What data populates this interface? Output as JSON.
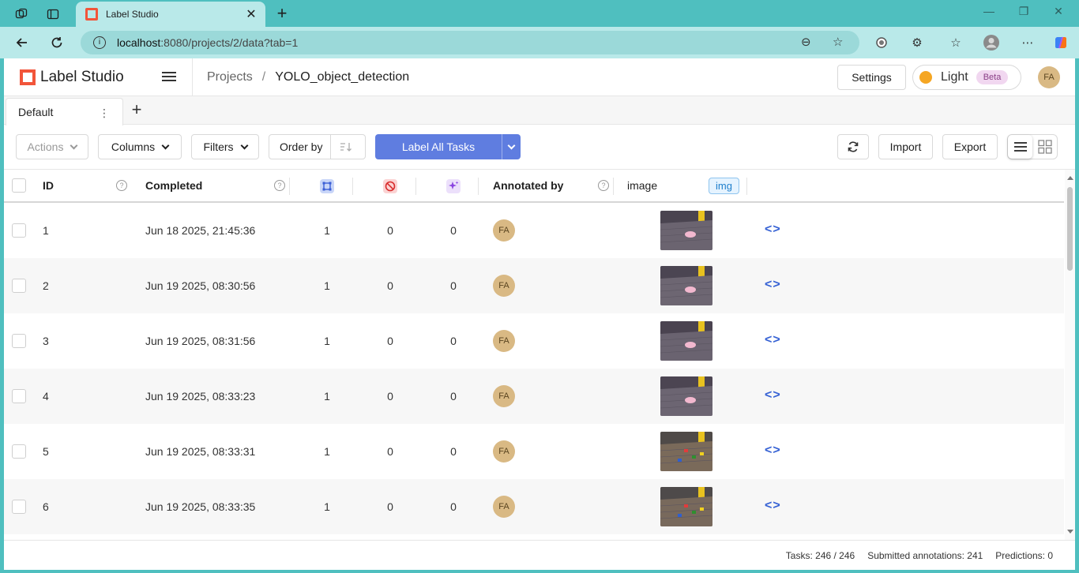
{
  "browser": {
    "tab_title": "Label Studio",
    "url_host": "localhost",
    "url_path": ":8080/projects/2/data?tab=1"
  },
  "app": {
    "logo_text": "Label Studio",
    "breadcrumb": {
      "parent": "Projects",
      "separator": "/",
      "current": "YOLO_object_detection"
    },
    "settings_label": "Settings",
    "theme_label": "Light",
    "theme_badge": "Beta",
    "user_initials": "FA"
  },
  "views": {
    "tabs": [
      {
        "label": "Default"
      }
    ],
    "menu_glyph": "⋮",
    "add_glyph": "+"
  },
  "toolbar": {
    "actions_label": "Actions",
    "columns_label": "Columns",
    "filters_label": "Filters",
    "order_label": "Order by",
    "label_all_label": "Label All Tasks",
    "import_label": "Import",
    "export_label": "Export"
  },
  "table": {
    "headers": {
      "id": "ID",
      "completed": "Completed",
      "annotated_by": "Annotated by",
      "image": "image",
      "image_badge": "img"
    },
    "rows": [
      {
        "id": "1",
        "completed": "Jun 18 2025, 21:45:36",
        "annotations": "1",
        "cancelled": "0",
        "predictions": "0",
        "annotator": "FA",
        "code": "<>"
      },
      {
        "id": "2",
        "completed": "Jun 19 2025, 08:30:56",
        "annotations": "1",
        "cancelled": "0",
        "predictions": "0",
        "annotator": "FA",
        "code": "<>"
      },
      {
        "id": "3",
        "completed": "Jun 19 2025, 08:31:56",
        "annotations": "1",
        "cancelled": "0",
        "predictions": "0",
        "annotator": "FA",
        "code": "<>"
      },
      {
        "id": "4",
        "completed": "Jun 19 2025, 08:33:23",
        "annotations": "1",
        "cancelled": "0",
        "predictions": "0",
        "annotator": "FA",
        "code": "<>"
      },
      {
        "id": "5",
        "completed": "Jun 19 2025, 08:33:31",
        "annotations": "1",
        "cancelled": "0",
        "predictions": "0",
        "annotator": "FA",
        "code": "<>"
      },
      {
        "id": "6",
        "completed": "Jun 19 2025, 08:33:35",
        "annotations": "1",
        "cancelled": "0",
        "predictions": "0",
        "annotator": "FA",
        "code": "<>"
      }
    ]
  },
  "footer": {
    "tasks": "Tasks: 246 / 246",
    "submitted": "Submitted annotations: 241",
    "predictions": "Predictions: 0"
  },
  "colors": {
    "browser_frame": "#4fbfbf",
    "brand": "#f2553a",
    "primary_button": "#5f7de0",
    "avatar": "#d9b984"
  }
}
